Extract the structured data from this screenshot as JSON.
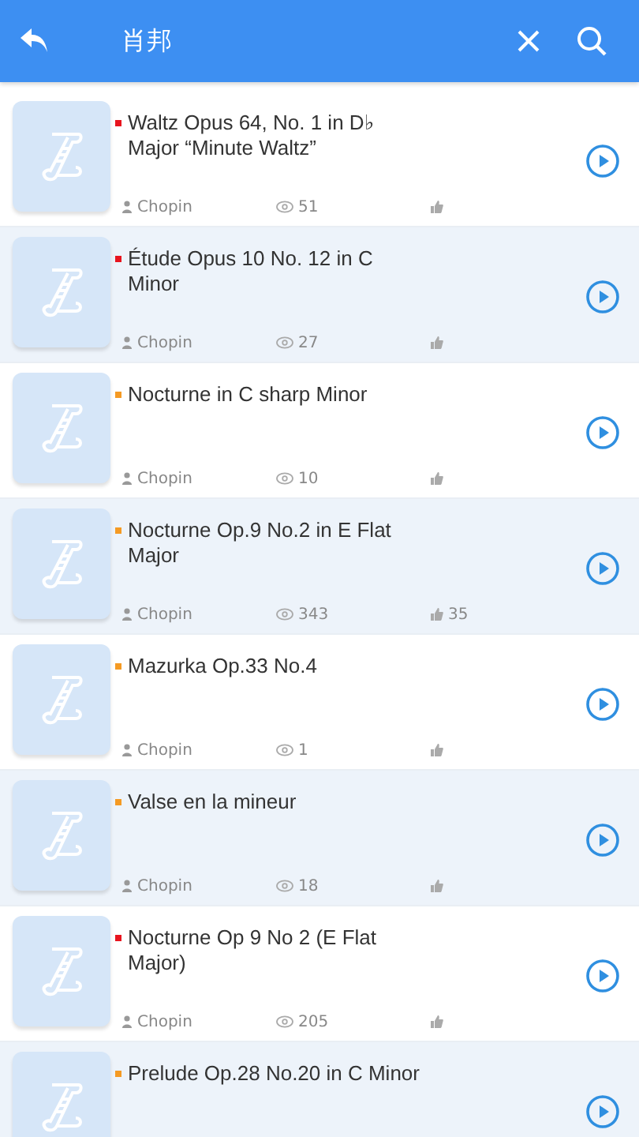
{
  "header": {
    "title": "肖邦"
  },
  "songs": [
    {
      "title": "Waltz Opus 64, No. 1 in D♭ Major “Minute Waltz”",
      "color": "#e8141e",
      "author": "Chopin",
      "views": "51"
    },
    {
      "title": "Étude Opus 10 No. 12 in C Minor",
      "color": "#e8141e",
      "author": "Chopin",
      "views": "27"
    },
    {
      "title": "Nocturne in C sharp Minor",
      "color": "#f59a23",
      "author": "Chopin",
      "views": "10"
    },
    {
      "title": "Nocturne Op.9 No.2 in E Flat Major",
      "color": "#f59a23",
      "author": "Chopin",
      "views": "343",
      "likes": "35"
    },
    {
      "title": "Mazurka Op.33 No.4",
      "color": "#f59a23",
      "author": "Chopin",
      "views": "1"
    },
    {
      "title": "Valse en la mineur",
      "color": "#f59a23",
      "author": "Chopin",
      "views": "18"
    },
    {
      "title": "Nocturne Op 9 No 2 (E Flat Major)",
      "color": "#e8141e",
      "author": "Chopin",
      "views": "205"
    },
    {
      "title": "Prelude Op.28 No.20 in C Minor",
      "color": "#f59a23"
    }
  ]
}
